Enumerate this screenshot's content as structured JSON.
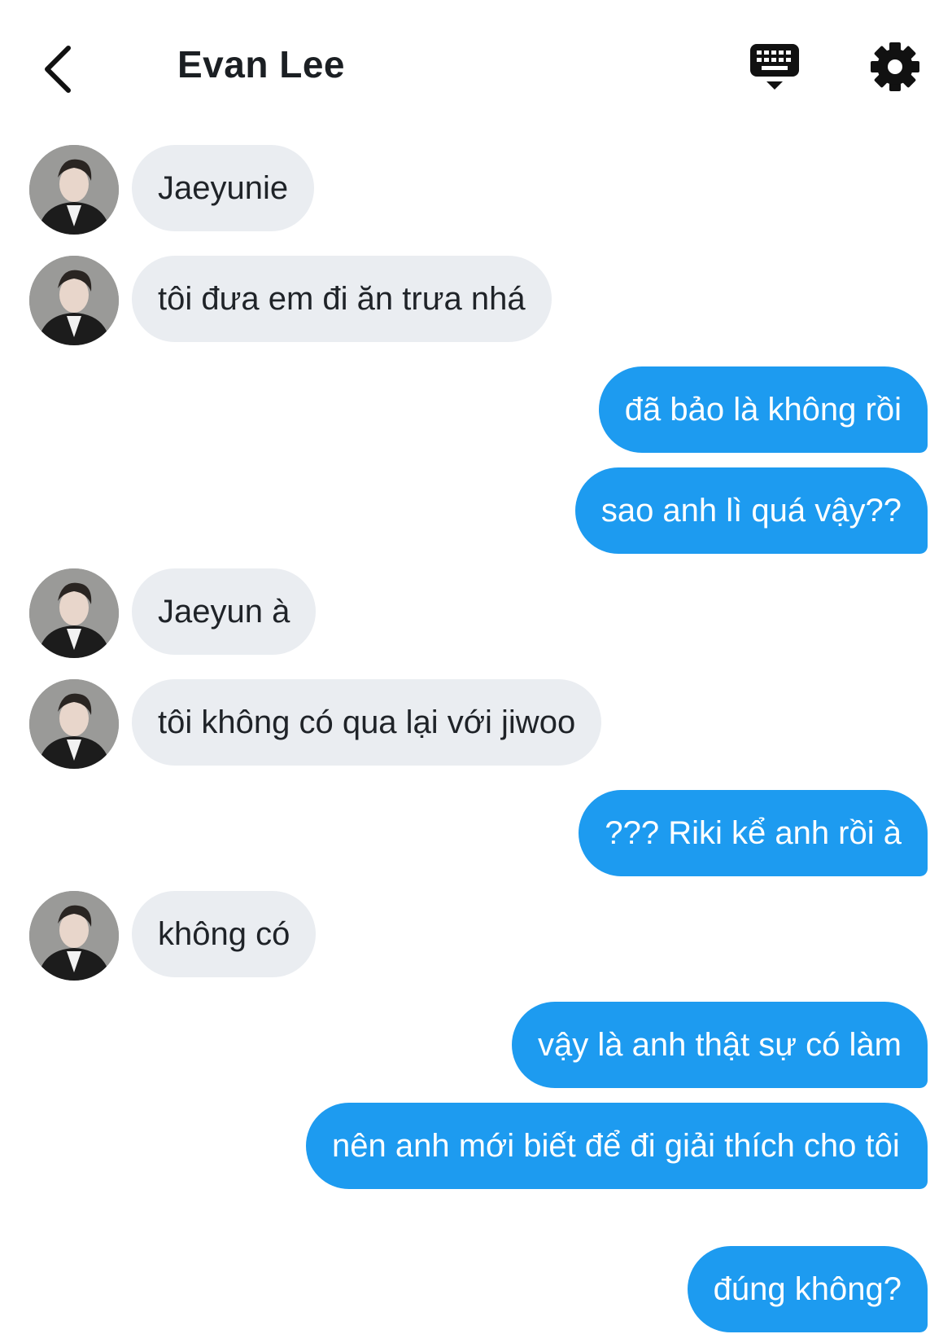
{
  "header": {
    "title": "Evan Lee",
    "back_icon": "chevron-left-icon",
    "keyboard_icon": "keyboard-icon",
    "settings_icon": "gear-icon"
  },
  "colors": {
    "incoming_bubble": "#eaedf1",
    "outgoing_bubble": "#1d9bf0",
    "outgoing_text": "#ffffff"
  },
  "messages": [
    {
      "from": "them",
      "text": "Jaeyunie"
    },
    {
      "from": "them",
      "text": "tôi đưa em đi ăn trưa nhá"
    },
    {
      "from": "me",
      "text": "đã bảo là không rồi"
    },
    {
      "from": "me",
      "text": "sao anh lì quá vậy??"
    },
    {
      "from": "them",
      "text": "Jaeyun à"
    },
    {
      "from": "them",
      "text": "tôi không có qua lại với jiwoo"
    },
    {
      "from": "me",
      "text": "??? Riki kể anh rồi à"
    },
    {
      "from": "them",
      "text": "không có"
    },
    {
      "from": "me",
      "text": "vậy là anh thật sự có làm"
    },
    {
      "from": "me",
      "text": "nên anh mới biết để đi giải thích cho tôi"
    },
    {
      "from": "me",
      "text": "đúng không?"
    }
  ]
}
